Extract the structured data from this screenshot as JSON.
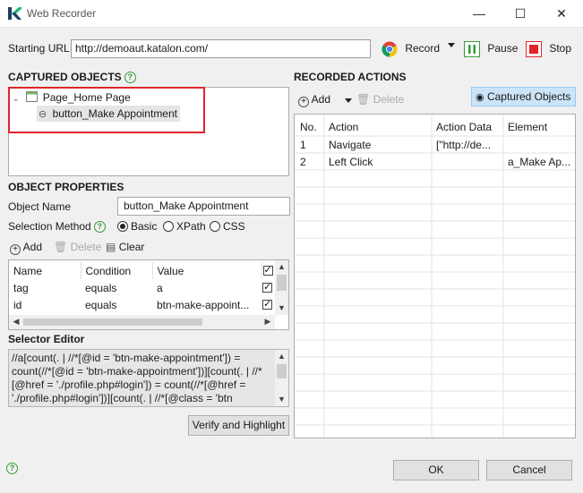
{
  "window": {
    "title": "Web Recorder",
    "minimize_glyph": "—",
    "maximize_glyph": "☐",
    "close_glyph": "✕"
  },
  "toolbar": {
    "url_label": "Starting URL",
    "url_value": "http://demoaut.katalon.com/",
    "record_label": "Record",
    "pause_label": "Pause",
    "stop_label": "Stop"
  },
  "captured_objects": {
    "header": "CAPTURED OBJECTS",
    "tree": {
      "page_label": "Page_Home Page",
      "child_label": "button_Make Appointment"
    }
  },
  "object_properties": {
    "header": "OBJECT PROPERTIES",
    "name_label": "Object Name",
    "name_value": "button_Make Appointment",
    "method_label": "Selection Method",
    "methods": [
      "Basic",
      "XPath",
      "CSS"
    ],
    "selected_method": "Basic",
    "add_label": "Add",
    "delete_label": "Delete",
    "clear_label": "Clear",
    "columns": [
      "Name",
      "Condition",
      "Value"
    ],
    "rows": [
      {
        "name": "tag",
        "condition": "equals",
        "value": "a",
        "checked": true
      },
      {
        "name": "id",
        "condition": "equals",
        "value": "btn-make-appoint...",
        "checked": true
      }
    ]
  },
  "selector_editor": {
    "header": "Selector Editor",
    "lines": [
      "//a[count(. | //*[@id = 'btn-make-appointment']) =",
      "count(//*[@id = 'btn-make-appointment'])][count(. | //*",
      "[@href = './profile.php#login']) = count(//*[@href =",
      "'./profile.php#login'])][count(. | //*[@class = 'btn"
    ],
    "verify_label": "Verify and Highlight"
  },
  "recorded_actions": {
    "header": "RECORDED ACTIONS",
    "add_label": "Add",
    "delete_label": "Delete",
    "captured_toggle_label": "Captured Objects",
    "columns": [
      "No.",
      "Action",
      "Action Data",
      "Element"
    ],
    "rows": [
      {
        "no": "1",
        "action": "Navigate",
        "data": "[\"http://de...",
        "element": ""
      },
      {
        "no": "2",
        "action": "Left Click",
        "data": "",
        "element": "a_Make Ap..."
      }
    ]
  },
  "footer": {
    "ok_label": "OK",
    "cancel_label": "Cancel"
  },
  "colors": {
    "accent_red": "#e0252b",
    "pause_green": "#3a9b3a",
    "stop_red": "#e0252b",
    "toggle_bg": "#cce4f7"
  }
}
